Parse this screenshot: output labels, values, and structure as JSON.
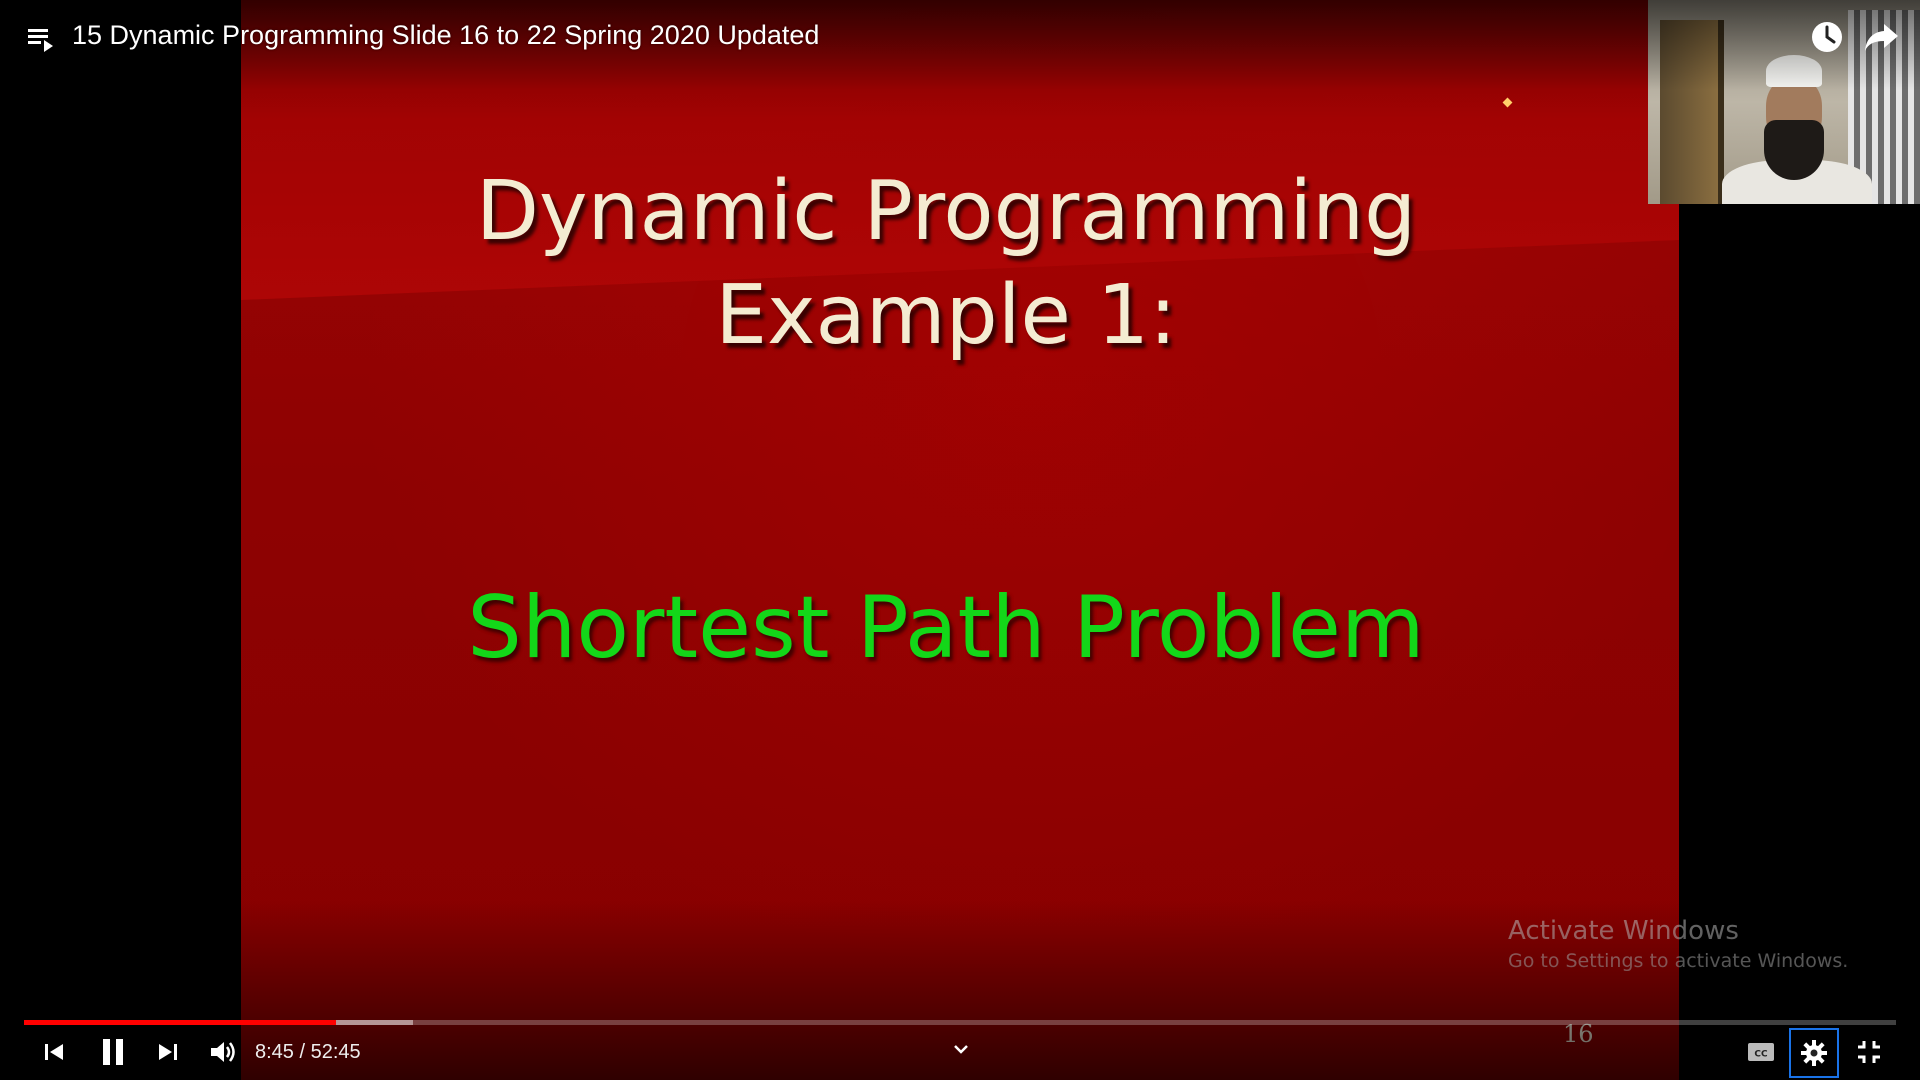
{
  "player": {
    "title": "15 Dynamic Programming Slide 16 to 22 Spring 2020 Updated",
    "current_time": "8:45",
    "duration": "52:45",
    "time_separator": " / ",
    "progress_fraction": 0.1667,
    "buffered_fraction": 0.2077,
    "accent_color": "#ff0000",
    "focus_color": "#1a73e8"
  },
  "slide": {
    "title_line1": "Dynamic Programming",
    "title_line2": "Example 1:",
    "subtitle": "Shortest Path Problem",
    "page_number": "16",
    "background_color": "#8e0202",
    "title_color": "#f4ecd2",
    "subtitle_color": "#13d719"
  },
  "watermark": {
    "title": "Activate Windows",
    "subtitle": "Go to Settings to activate Windows."
  },
  "icons": {
    "playlist": "playlist-icon",
    "watch_later": "clock-icon",
    "share": "share-arrow-icon",
    "previous": "skip-previous-icon",
    "pause": "pause-icon",
    "next": "skip-next-icon",
    "volume": "volume-icon",
    "chapters": "chevron-down-icon",
    "captions": "cc-icon",
    "settings": "gear-icon",
    "exit_fullscreen": "exit-fullscreen-icon"
  }
}
